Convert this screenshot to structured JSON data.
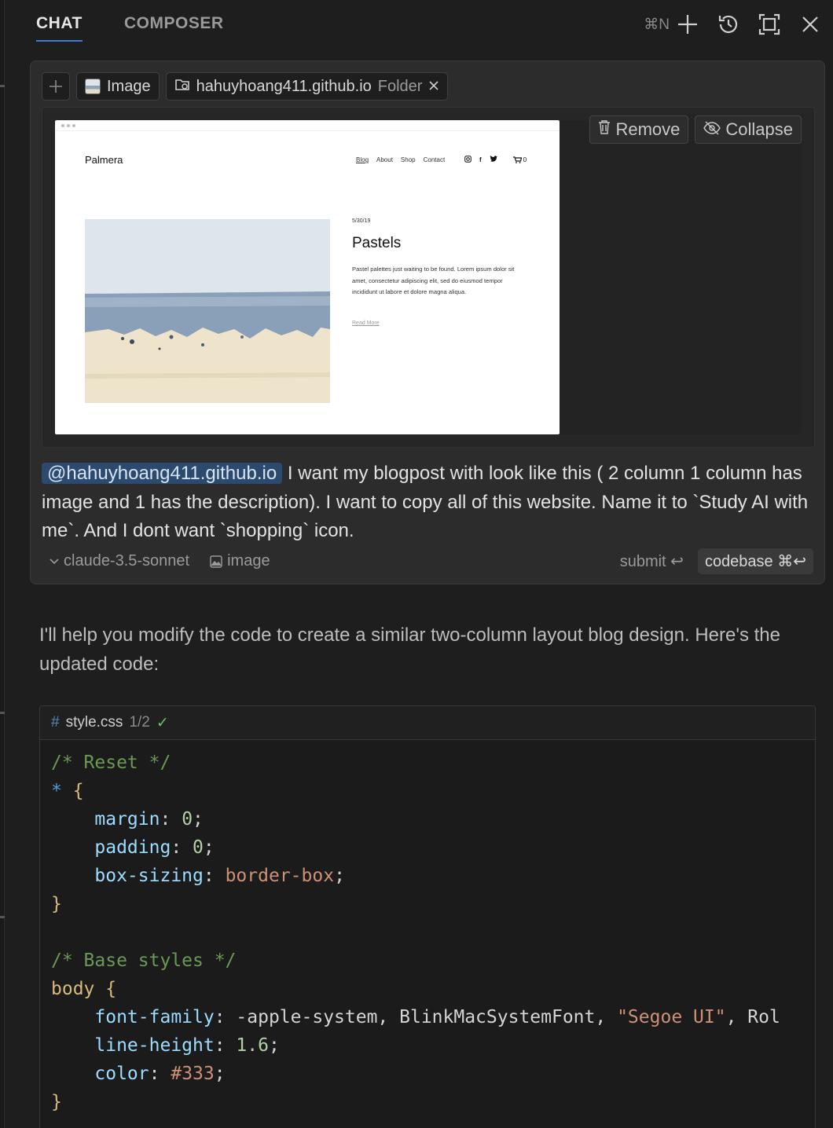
{
  "tabs": {
    "chat": "CHAT",
    "composer": "COMPOSER"
  },
  "header": {
    "shortcut": "⌘N"
  },
  "pills": {
    "image_label": "Image",
    "folder_name": "hahuyhoang411.github.io",
    "folder_type": "Folder"
  },
  "preview": {
    "site_name": "Palmera",
    "nav": [
      "Blog",
      "About",
      "Shop",
      "Contact"
    ],
    "cart_count": "0",
    "post_date": "5/30/19",
    "post_title": "Pastels",
    "post_body": "Pastel palettes just waiting to be found. Lorem ipsum dolor sit amet, consectetur adipiscing elit, sed do eiusmod tempor incididunt ut labore et dolore magna aliqua.",
    "read_more": "Read More",
    "remove_label": "Remove",
    "collapse_label": "Collapse"
  },
  "prompt": {
    "mention": "@hahuyhoang411.github.io",
    "text": " I want my blogpost with look like this ( 2 column 1 column has image and 1 has the description). I want to copy all of this website. Name it to `Study AI with me`. And I dont want `shopping` icon."
  },
  "footer": {
    "model": "claude-3.5-sonnet",
    "image_toggle": "image",
    "submit": "submit ↩",
    "codebase": "codebase ⌘↩"
  },
  "reply": {
    "text": "I'll help you modify the code to create a similar two-column layout blog design. Here's the updated code:"
  },
  "code_block": {
    "filename": "style.css",
    "fraction": "1/2",
    "lines": {
      "l1": "/* Reset */",
      "l2_sel": "*",
      "l3_prop": "margin",
      "l3_val": "0",
      "l4_prop": "padding",
      "l4_val": "0",
      "l5_prop": "box-sizing",
      "l5_val": "border-box",
      "l8": "/* Base styles */",
      "l9_sel": "body",
      "l10_prop": "font-family",
      "l10_val_a": "-apple-system, BlinkMacSystemFont, ",
      "l10_val_str": "\"Segoe UI\"",
      "l10_val_b": ", Rol",
      "l11_prop": "line-height",
      "l11_val": "1.6",
      "l12_prop": "color",
      "l12_val": "#333"
    }
  },
  "colors": {
    "accent": "#3a7bd5",
    "background": "#1e1e1e",
    "card": "#2c2c2c",
    "mention_bg": "#2b4a6e"
  }
}
